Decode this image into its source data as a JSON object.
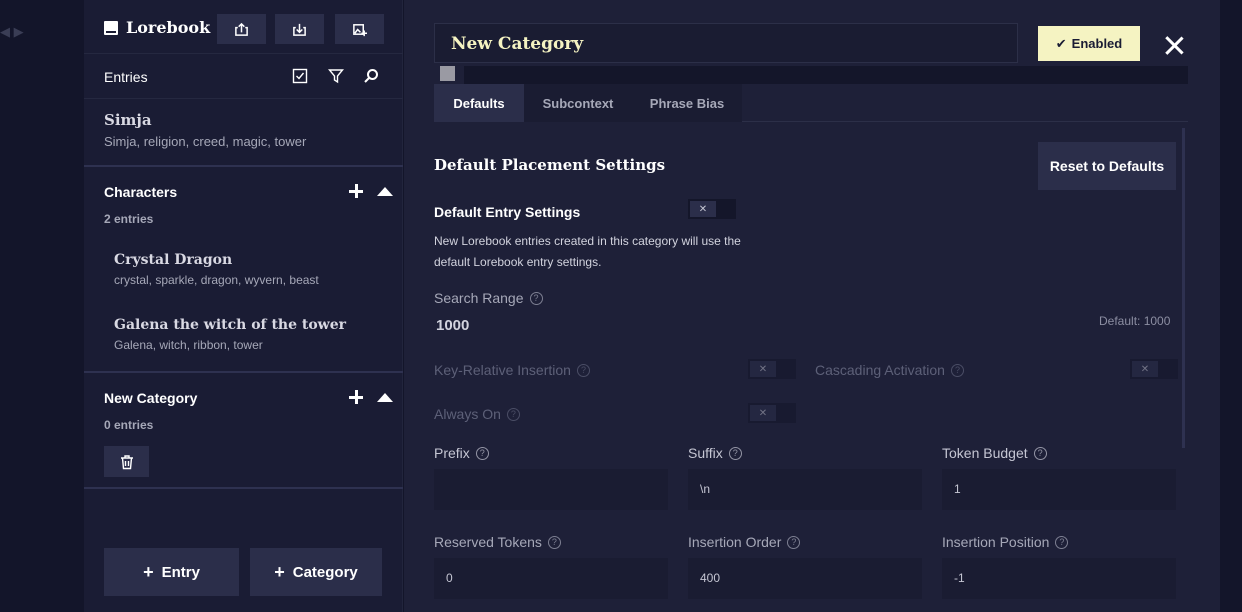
{
  "sidebar": {
    "title": "Lorebook",
    "entries_label": "Entries",
    "top_entry": {
      "name": "Simja",
      "keys": "Simja, religion, creed, magic, tower"
    },
    "categories": [
      {
        "title": "Characters",
        "count": "2 entries",
        "entries": [
          {
            "name": "Crystal Dragon",
            "keys": "crystal, sparkle, dragon, wyvern, beast"
          },
          {
            "name": "Galena the witch of the tower",
            "keys": "Galena, witch, ribbon, tower"
          }
        ]
      },
      {
        "title": "New Category",
        "count": "0 entries"
      }
    ],
    "add_entry_label": "Entry",
    "add_category_label": "Category"
  },
  "main": {
    "category_name": "New Category",
    "enabled_label": "Enabled",
    "tabs": [
      {
        "label": "Defaults"
      },
      {
        "label": "Subcontext"
      },
      {
        "label": "Phrase Bias"
      }
    ],
    "section_title": "Default Placement Settings",
    "reset_label": "Reset to Defaults",
    "default_entry_title": "Default Entry Settings",
    "default_entry_desc": "New Lorebook entries created in this category will use the default Lorebook entry settings.",
    "search_range": {
      "label": "Search Range",
      "value": "1000",
      "default": "Default: 1000"
    },
    "key_relative_label": "Key-Relative Insertion",
    "cascading_label": "Cascading Activation",
    "always_on_label": "Always On",
    "fields": [
      {
        "label": "Prefix",
        "value": ""
      },
      {
        "label": "Suffix",
        "value": "\\n"
      },
      {
        "label": "Token Budget",
        "value": "1"
      },
      {
        "label": "Reserved Tokens",
        "value": "0"
      },
      {
        "label": "Insertion Order",
        "value": "400"
      },
      {
        "label": "Insertion Position",
        "value": "-1"
      }
    ],
    "toggle_off_glyph": "✕"
  },
  "colors": {
    "accent": "#f5f3c2",
    "sidebar_bg": "#1a1c34",
    "main_bg": "#1e2038",
    "button_bg": "#2b2e4a"
  }
}
